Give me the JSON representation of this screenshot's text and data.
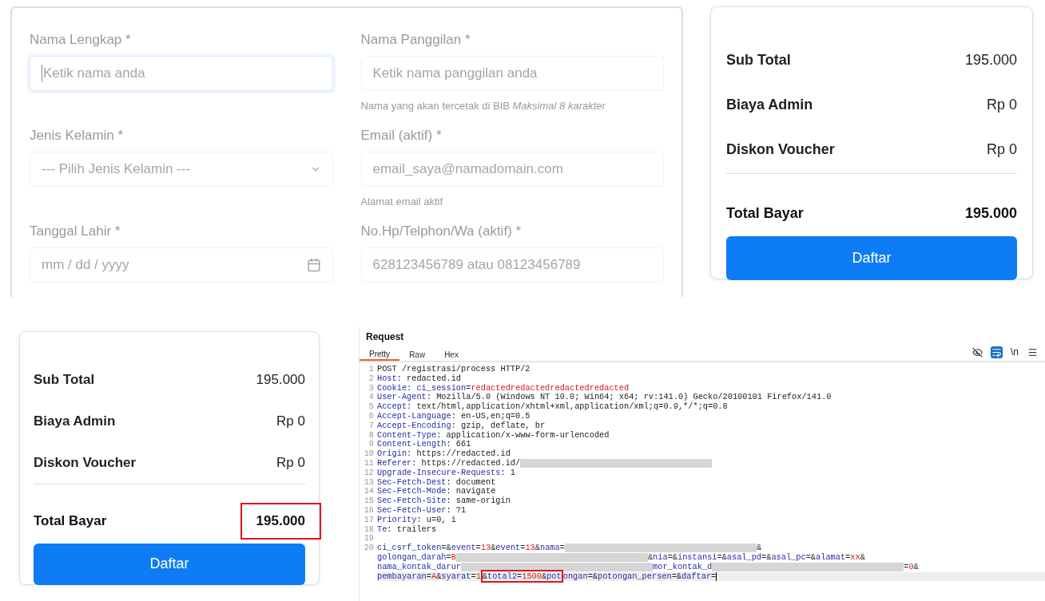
{
  "form": {
    "fields": [
      {
        "label": "Nama Lengkap *",
        "kind": "text",
        "placeholder": "Ketik nama anda",
        "focused": true
      },
      {
        "label": "Nama Panggilan *",
        "kind": "text",
        "placeholder": "Ketik nama panggilan anda",
        "focused": false,
        "help": "Nama yang akan tercetak di BIB *Maksimal 8 karakter*"
      },
      {
        "label": "Jenis Kelamin *",
        "kind": "select",
        "placeholder": "--- Pilih Jenis Kelamin ---",
        "focused": false
      },
      {
        "label": "Email (aktif) *",
        "kind": "text",
        "placeholder": "email_saya@namadomain.com",
        "focused": false,
        "help": "Alamat email aktif"
      },
      {
        "label": "Tanggal Lahir *",
        "kind": "date",
        "placeholder": "mm / dd / yyyy",
        "focused": false
      },
      {
        "label": "No.Hp/Telphon/Wa (aktif) *",
        "kind": "text",
        "placeholder": "628123456789 atau 08123456789",
        "focused": false
      }
    ]
  },
  "summary_cards": [
    {
      "rows": [
        {
          "label": "Sub Total",
          "value": "195.000"
        },
        {
          "label": "Biaya Admin",
          "value": "Rp 0"
        },
        {
          "label": "Diskon Voucher",
          "value": "Rp 0"
        }
      ],
      "total": {
        "label": "Total Bayar",
        "value": "195.000",
        "highlighted": false
      },
      "button": "Daftar"
    },
    {
      "rows": [
        {
          "label": "Sub Total",
          "value": "195.000"
        },
        {
          "label": "Biaya Admin",
          "value": "Rp 0"
        },
        {
          "label": "Diskon Voucher",
          "value": "Rp 0"
        }
      ],
      "total": {
        "label": "Total Bayar",
        "value": "195.000",
        "highlighted": true
      },
      "button": "Daftar"
    }
  ],
  "request": {
    "title": "Request",
    "tabs": [
      {
        "label": "Pretty",
        "selected": true
      },
      {
        "label": "Raw",
        "selected": false
      },
      {
        "label": "Hex",
        "selected": false
      }
    ],
    "toolbar": [
      {
        "kind": "eye-off",
        "selected": false
      },
      {
        "kind": "wrap",
        "selected": true
      },
      {
        "kind": "text",
        "text": "\\n",
        "selected": false
      },
      {
        "kind": "menu",
        "selected": false
      }
    ],
    "lines": [
      {
        "number": "1",
        "segments": [
          {
            "kind": "text",
            "text": "POST /registrasi/process HTTP/2"
          }
        ]
      },
      {
        "number": "2",
        "segments": [
          {
            "kind": "key",
            "text": "Host"
          },
          {
            "kind": "text",
            "text": ": redacted.id"
          }
        ]
      },
      {
        "number": "3",
        "segments": [
          {
            "kind": "key",
            "text": "Cookie"
          },
          {
            "kind": "text",
            "text": ": "
          },
          {
            "kind": "key",
            "text": "ci_session"
          },
          {
            "kind": "text",
            "text": "="
          },
          {
            "kind": "red",
            "text": "redactedredactedredactedredacted"
          }
        ]
      },
      {
        "number": "4",
        "segments": [
          {
            "kind": "key",
            "text": "User-Agent"
          },
          {
            "kind": "text",
            "text": ": Mozilla/5.0 (Windows NT 10.0; Win64; x64; rv:141.0) Gecko/20100101 Firefox/141.0"
          }
        ]
      },
      {
        "number": "5",
        "segments": [
          {
            "kind": "key",
            "text": "Accept"
          },
          {
            "kind": "text",
            "text": ": text/html,application/xhtml+xml,application/xml;q=0.9,*/*;q=0.8"
          }
        ]
      },
      {
        "number": "6",
        "segments": [
          {
            "kind": "key",
            "text": "Accept-Language"
          },
          {
            "kind": "text",
            "text": ": en-US,en;q=0.5"
          }
        ]
      },
      {
        "number": "7",
        "segments": [
          {
            "kind": "key",
            "text": "Accept-Encoding"
          },
          {
            "kind": "text",
            "text": ": gzip, deflate, br"
          }
        ]
      },
      {
        "number": "8",
        "segments": [
          {
            "kind": "key",
            "text": "Content-Type"
          },
          {
            "kind": "text",
            "text": ": application/x-www-form-urlencoded"
          }
        ]
      },
      {
        "number": "9",
        "segments": [
          {
            "kind": "key",
            "text": "Content-Length"
          },
          {
            "kind": "text",
            "text": ": 661"
          }
        ]
      },
      {
        "number": "10",
        "segments": [
          {
            "kind": "key",
            "text": "Origin"
          },
          {
            "kind": "text",
            "text": ": https://redacted.id"
          }
        ]
      },
      {
        "number": "11",
        "segments": [
          {
            "kind": "key",
            "text": "Referer"
          },
          {
            "kind": "text",
            "text": ": https://redacted.id/"
          },
          {
            "kind": "redacted"
          }
        ]
      },
      {
        "number": "12",
        "segments": [
          {
            "kind": "key",
            "text": "Upgrade-Insecure-Requests"
          },
          {
            "kind": "text",
            "text": ": 1"
          }
        ]
      },
      {
        "number": "13",
        "segments": [
          {
            "kind": "key",
            "text": "Sec-Fetch-Dest"
          },
          {
            "kind": "text",
            "text": ": document"
          }
        ]
      },
      {
        "number": "14",
        "segments": [
          {
            "kind": "key",
            "text": "Sec-Fetch-Mode"
          },
          {
            "kind": "text",
            "text": ": navigate"
          }
        ]
      },
      {
        "number": "15",
        "segments": [
          {
            "kind": "key",
            "text": "Sec-Fetch-Site"
          },
          {
            "kind": "text",
            "text": ": same-origin"
          }
        ]
      },
      {
        "number": "16",
        "segments": [
          {
            "kind": "key",
            "text": "Sec-Fetch-User"
          },
          {
            "kind": "text",
            "text": ": ?1"
          }
        ]
      },
      {
        "number": "17",
        "segments": [
          {
            "kind": "key",
            "text": "Priority"
          },
          {
            "kind": "text",
            "text": ": u=0, i"
          }
        ]
      },
      {
        "number": "18",
        "segments": [
          {
            "kind": "key",
            "text": "Te"
          },
          {
            "kind": "text",
            "text": ": trailers"
          }
        ]
      },
      {
        "number": "19"
      },
      {
        "number": "20",
        "segments": [
          {
            "kind": "key",
            "text": "ci_csrf_token"
          },
          {
            "kind": "text",
            "text": "=&"
          },
          {
            "kind": "key",
            "text": "event"
          },
          {
            "kind": "text",
            "text": "="
          },
          {
            "kind": "red",
            "text": "13"
          },
          {
            "kind": "text",
            "text": "&"
          },
          {
            "kind": "key",
            "text": "event"
          },
          {
            "kind": "text",
            "text": "="
          },
          {
            "kind": "red",
            "text": "13"
          },
          {
            "kind": "text",
            "text": "&"
          },
          {
            "kind": "key",
            "text": "nama"
          },
          {
            "kind": "text",
            "text": "="
          },
          {
            "kind": "redacted"
          },
          {
            "kind": "text",
            "text": "&"
          }
        ]
      },
      {
        "segments": [
          {
            "kind": "key",
            "text": "golongan_darah"
          },
          {
            "kind": "text",
            "text": "="
          },
          {
            "kind": "red",
            "text": "B"
          },
          {
            "kind": "redacted"
          },
          {
            "kind": "text",
            "text": "&"
          },
          {
            "kind": "key",
            "text": "nia"
          },
          {
            "kind": "text",
            "text": "=&"
          },
          {
            "kind": "key",
            "text": "instansi"
          },
          {
            "kind": "text",
            "text": "=&"
          },
          {
            "kind": "key",
            "text": "asal_pd"
          },
          {
            "kind": "text",
            "text": "=&"
          },
          {
            "kind": "key",
            "text": "asal_pc"
          },
          {
            "kind": "text",
            "text": "=&"
          },
          {
            "kind": "key",
            "text": "alamat"
          },
          {
            "kind": "text",
            "text": "="
          },
          {
            "kind": "red",
            "text": "xx"
          },
          {
            "kind": "text",
            "text": "&"
          }
        ]
      },
      {
        "segments": [
          {
            "kind": "key",
            "text": "nama_kontak_darur"
          },
          {
            "kind": "redacted"
          },
          {
            "kind": "key",
            "text": "mor_kontak_d"
          },
          {
            "kind": "redacted"
          },
          {
            "kind": "text",
            "text": "="
          },
          {
            "kind": "red",
            "text": "0"
          },
          {
            "kind": "text",
            "text": "&"
          }
        ]
      },
      {
        "current": true,
        "segments": [
          {
            "kind": "key",
            "text": "pembayaran"
          },
          {
            "kind": "text",
            "text": "="
          },
          {
            "kind": "red",
            "text": "A"
          },
          {
            "kind": "text",
            "text": "&"
          },
          {
            "kind": "key",
            "text": "syarat"
          },
          {
            "kind": "text",
            "text": "="
          },
          {
            "kind": "red",
            "text": "1"
          },
          {
            "kind": "box",
            "segments": [
              {
                "kind": "text",
                "text": "&"
              },
              {
                "kind": "key",
                "text": "total2"
              },
              {
                "kind": "text",
                "text": "="
              },
              {
                "kind": "red",
                "text": "1500"
              },
              {
                "kind": "text",
                "text": "&"
              },
              {
                "kind": "key",
                "text": "pot"
              }
            ]
          },
          {
            "kind": "key",
            "text": "ongan"
          },
          {
            "kind": "text",
            "text": "=&"
          },
          {
            "kind": "key",
            "text": "potongan_persen"
          },
          {
            "kind": "text",
            "text": "=&"
          },
          {
            "kind": "key",
            "text": "daftar"
          },
          {
            "kind": "text",
            "text": "="
          }
        ]
      }
    ]
  }
}
